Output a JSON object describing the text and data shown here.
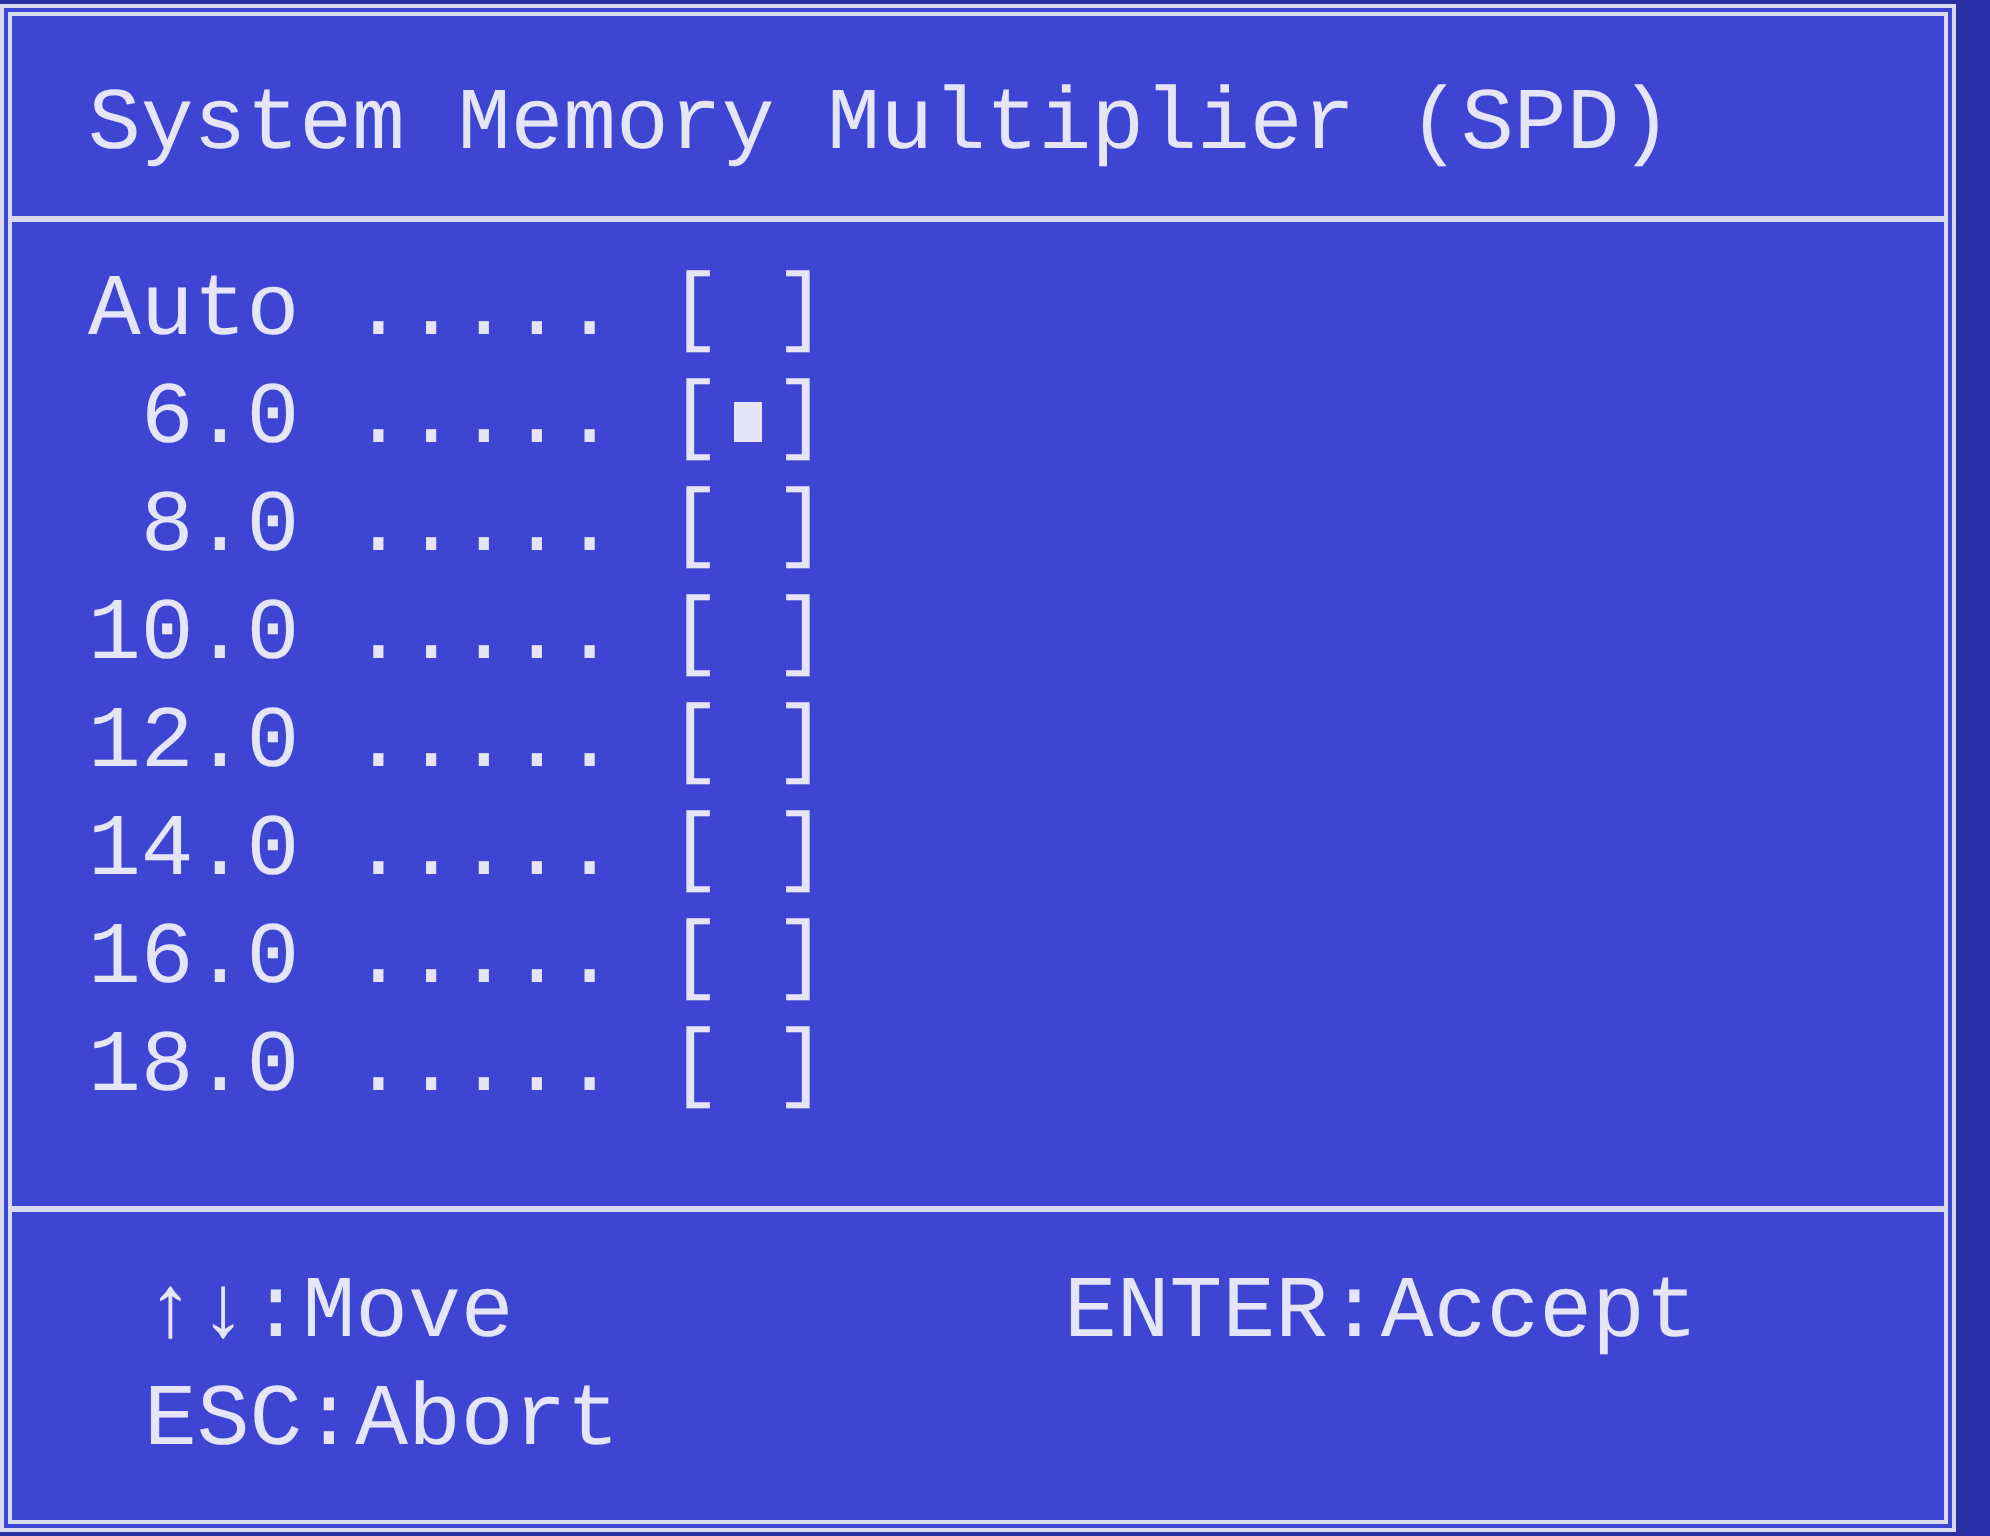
{
  "title": "System Memory Multiplier (SPD)",
  "options": [
    {
      "label": "Auto",
      "leader": ".....",
      "open": "[",
      "close": "]",
      "selected": false
    },
    {
      "label": "6.0",
      "leader": ".....",
      "open": "[",
      "close": "]",
      "selected": true
    },
    {
      "label": "8.0",
      "leader": ".....",
      "open": "[",
      "close": "]",
      "selected": false
    },
    {
      "label": "10.0",
      "leader": ".....",
      "open": "[",
      "close": "]",
      "selected": false
    },
    {
      "label": "12.0",
      "leader": ".....",
      "open": "[",
      "close": "]",
      "selected": false
    },
    {
      "label": "14.0",
      "leader": ".....",
      "open": "[",
      "close": "]",
      "selected": false
    },
    {
      "label": "16.0",
      "leader": ".....",
      "open": "[",
      "close": "]",
      "selected": false
    },
    {
      "label": "18.0",
      "leader": ".....",
      "open": "[",
      "close": "]",
      "selected": false
    }
  ],
  "help": [
    "↑↓:Move",
    "ENTER:Accept",
    "ESC:Abort"
  ]
}
